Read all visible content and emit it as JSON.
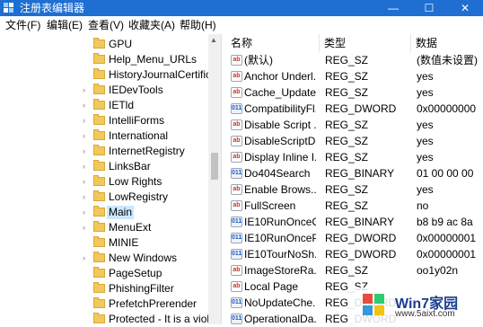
{
  "window": {
    "title": "注册表编辑器",
    "minimize": "—",
    "maximize": "☐",
    "close": "✕"
  },
  "menu": [
    "文件(F)",
    "编辑(E)",
    "查看(V)",
    "收藏夹(A)",
    "帮助(H)"
  ],
  "tree": [
    {
      "label": "GPU",
      "expandable": false,
      "selected": false
    },
    {
      "label": "Help_Menu_URLs",
      "expandable": false,
      "selected": false
    },
    {
      "label": "HistoryJournalCertifica",
      "expandable": false,
      "selected": false
    },
    {
      "label": "IEDevTools",
      "expandable": true,
      "selected": false
    },
    {
      "label": "IETld",
      "expandable": true,
      "selected": false
    },
    {
      "label": "IntelliForms",
      "expandable": true,
      "selected": false
    },
    {
      "label": "International",
      "expandable": true,
      "selected": false
    },
    {
      "label": "InternetRegistry",
      "expandable": true,
      "selected": false
    },
    {
      "label": "LinksBar",
      "expandable": true,
      "selected": false
    },
    {
      "label": "Low Rights",
      "expandable": true,
      "selected": false
    },
    {
      "label": "LowRegistry",
      "expandable": true,
      "selected": false
    },
    {
      "label": "Main",
      "expandable": true,
      "selected": true
    },
    {
      "label": "MenuExt",
      "expandable": true,
      "selected": false
    },
    {
      "label": "MINIE",
      "expandable": false,
      "selected": false
    },
    {
      "label": "New Windows",
      "expandable": true,
      "selected": false
    },
    {
      "label": "PageSetup",
      "expandable": false,
      "selected": false
    },
    {
      "label": "PhishingFilter",
      "expandable": false,
      "selected": false
    },
    {
      "label": "PrefetchPrerender",
      "expandable": false,
      "selected": false
    },
    {
      "label": "Protected - It is a viola",
      "expandable": false,
      "selected": false
    }
  ],
  "list": {
    "headers": [
      "名称",
      "类型",
      "数据"
    ],
    "rows": [
      {
        "icon": "sz",
        "name": "(默认)",
        "type": "REG_SZ",
        "data": "(数值未设置)"
      },
      {
        "icon": "sz",
        "name": "Anchor Underl...",
        "type": "REG_SZ",
        "data": "yes"
      },
      {
        "icon": "sz",
        "name": "Cache_Update...",
        "type": "REG_SZ",
        "data": "yes"
      },
      {
        "icon": "bin",
        "name": "CompatibilityFl...",
        "type": "REG_DWORD",
        "data": "0x00000000"
      },
      {
        "icon": "sz",
        "name": "Disable Script ...",
        "type": "REG_SZ",
        "data": "yes"
      },
      {
        "icon": "sz",
        "name": "DisableScriptD...",
        "type": "REG_SZ",
        "data": "yes"
      },
      {
        "icon": "sz",
        "name": "Display Inline I...",
        "type": "REG_SZ",
        "data": "yes"
      },
      {
        "icon": "bin",
        "name": "Do404Search",
        "type": "REG_BINARY",
        "data": "01 00 00 00"
      },
      {
        "icon": "sz",
        "name": "Enable Brows...",
        "type": "REG_SZ",
        "data": "yes"
      },
      {
        "icon": "sz",
        "name": "FullScreen",
        "type": "REG_SZ",
        "data": "no"
      },
      {
        "icon": "bin",
        "name": "IE10RunOnceC...",
        "type": "REG_BINARY",
        "data": "b8 b9 ac 8a"
      },
      {
        "icon": "bin",
        "name": "IE10RunOnceP...",
        "type": "REG_DWORD",
        "data": "0x00000001"
      },
      {
        "icon": "bin",
        "name": "IE10TourNoSh...",
        "type": "REG_DWORD",
        "data": "0x00000001"
      },
      {
        "icon": "sz",
        "name": "ImageStoreRa...",
        "type": "REG_SZ",
        "data": "oo1y02n"
      },
      {
        "icon": "sz",
        "name": "Local Page",
        "type": "REG_SZ",
        "data": ""
      },
      {
        "icon": "bin",
        "name": "NoUpdateChe...",
        "type": "REG_DWORD",
        "data": ""
      },
      {
        "icon": "bin",
        "name": "OperationalDa...",
        "type": "REG_DWORD",
        "data": ""
      }
    ]
  },
  "watermark": {
    "brand": "Win7家园",
    "url": "www.5aixt.com"
  },
  "colors": {
    "titlebar": "#1e6fd1",
    "selection": "#cce8ff",
    "folder": "#f1c85b"
  }
}
